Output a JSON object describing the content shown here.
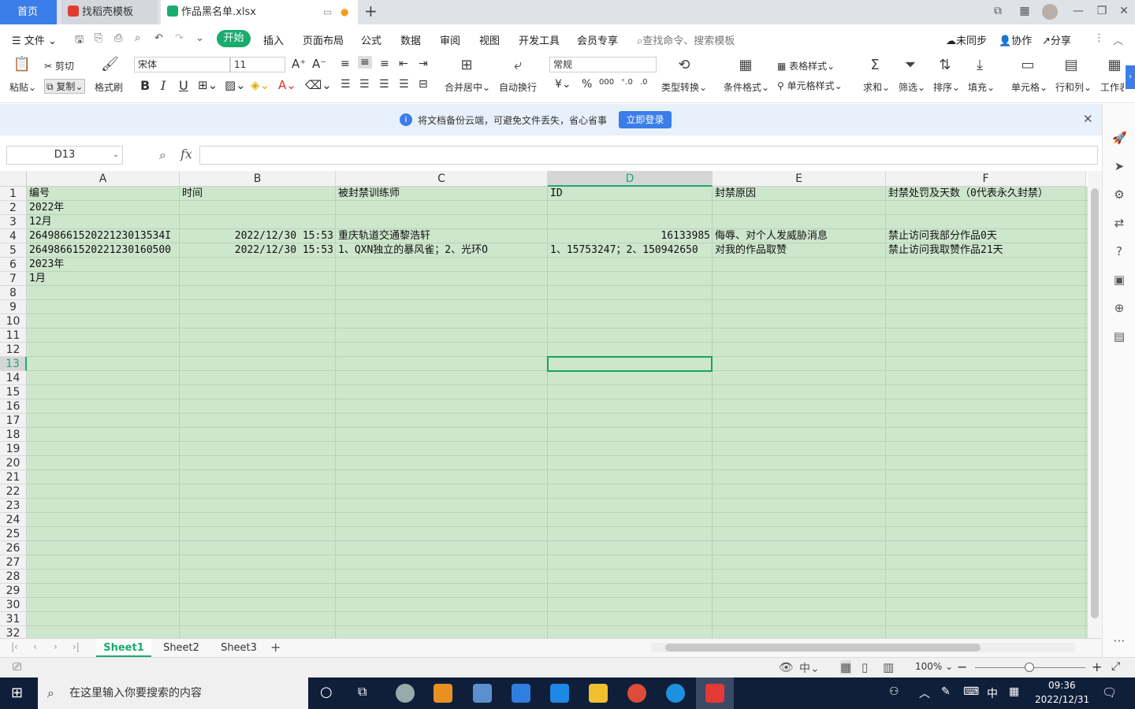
{
  "tabs": {
    "home": "首页",
    "template": "找稻壳模板",
    "file": "作品黑名单.xlsx",
    "add": "+"
  },
  "menubar": {
    "file_menu": "文件",
    "start": "开始",
    "items": [
      "插入",
      "页面布局",
      "公式",
      "数据",
      "审阅",
      "视图",
      "开发工具",
      "会员专享"
    ],
    "search_placeholder": "查找命令、搜索模板",
    "sync": "未同步",
    "collab": "协作",
    "share": "分享"
  },
  "ribbon": {
    "paste": "粘贴",
    "cut": "剪切",
    "copy": "复制",
    "format_painter": "格式刷",
    "font_name": "宋体",
    "font_size": "11",
    "merge_center": "合并居中",
    "wrap_text": "自动换行",
    "number_format": "常规",
    "type_convert": "类型转换",
    "cond_format": "条件格式",
    "table_style": "表格样式",
    "cell_style": "单元格样式",
    "sum": "求和",
    "filter": "筛选",
    "sort": "排序",
    "fill": "填充",
    "cell": "单元格",
    "row_col": "行和列",
    "worksheet": "工作表",
    "bold": "B",
    "italic": "I",
    "underline": "U",
    "currency": "¥",
    "percent": "%",
    "thousands": "000"
  },
  "notify": {
    "text": "将文档备份云端，可避免文件丢失，省心省事",
    "login": "立即登录"
  },
  "formula": {
    "namebox": "D13",
    "fx": "fx",
    "value": ""
  },
  "columns": [
    "A",
    "B",
    "C",
    "D",
    "E",
    "F"
  ],
  "rows": [
    "1",
    "2",
    "3",
    "4",
    "5",
    "6",
    "7",
    "8",
    "9",
    "10",
    "11",
    "12",
    "13",
    "14",
    "15",
    "16",
    "17",
    "18",
    "19",
    "20",
    "21",
    "22",
    "23",
    "24",
    "25",
    "26",
    "27",
    "28",
    "29",
    "30",
    "31",
    "32"
  ],
  "cells": {
    "A1": "编号",
    "B1": "时间",
    "C1": "被封禁训练师",
    "D1": "ID",
    "E1": "封禁原因",
    "F1": "封禁处罚及天数（0代表永久封禁）",
    "A2": "2022年",
    "A3": "12月",
    "A4": "2649866152022123013534I",
    "B4": "2022/12/30 15:53",
    "C4": "重庆轨道交通黎浩轩",
    "D4": "16133985",
    "E4": "侮辱、对个人发威胁消息",
    "F4": "禁止访问我部分作品0天",
    "A5": "26498661520221230160500",
    "B5": "2022/12/30 15:53",
    "C5": "1、QXN独立的暴风雀；2、光环O",
    "D5": "1、15753247；2、150942650",
    "E5": "对我的作品取赞",
    "F5": "禁止访问我取赞作品21天",
    "A6": "2023年",
    "A7": "1月"
  },
  "sheets": [
    "Sheet1",
    "Sheet2",
    "Sheet3"
  ],
  "status": {
    "zoom": "100%"
  },
  "taskbar": {
    "search_placeholder": "在这里输入你要搜索的内容",
    "ime": "中",
    "time": "09:36",
    "date": "2022/12/31"
  },
  "colors": {
    "accent_green": "#1aab6e",
    "cell_fill": "#cde6cc",
    "home_tab": "#3b7de9"
  }
}
